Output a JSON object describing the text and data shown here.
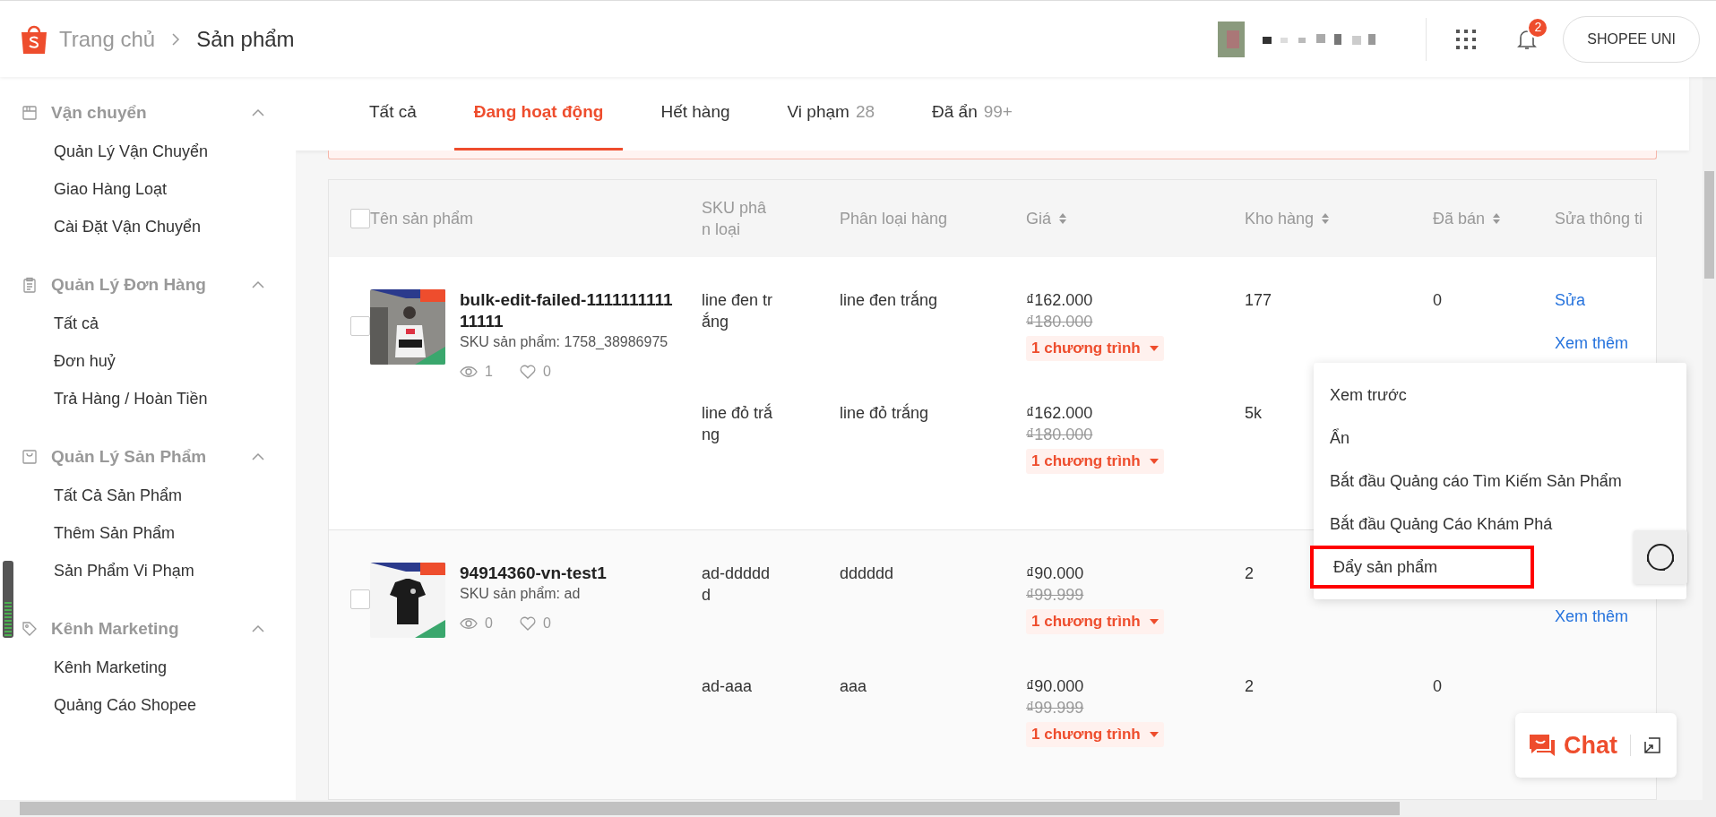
{
  "header": {
    "breadcrumb": [
      "Trang chủ",
      "Sản phẩm"
    ],
    "notification_count": "2",
    "account_button": "SHOPEE UNI"
  },
  "sidebar": [
    {
      "title": "Vận chuyển",
      "expanded": true,
      "items": [
        "Quản Lý Vận Chuyển",
        "Giao Hàng Loạt",
        "Cài Đặt Vận Chuyển"
      ]
    },
    {
      "title": "Quản Lý Đơn Hàng",
      "expanded": true,
      "items": [
        "Tất cả",
        "Đơn huỷ",
        "Trả Hàng / Hoàn Tiền"
      ]
    },
    {
      "title": "Quản Lý Sản Phẩm",
      "expanded": true,
      "items": [
        "Tất Cả Sản Phẩm",
        "Thêm Sản Phẩm",
        "Sản Phẩm Vi Phạm"
      ]
    },
    {
      "title": "Kênh Marketing",
      "expanded": true,
      "items": [
        "Kênh Marketing",
        "Quảng Cáo Shopee"
      ]
    }
  ],
  "tabs": [
    {
      "label": "Tất cả",
      "selected": false
    },
    {
      "label": "Đang hoạt động",
      "selected": true
    },
    {
      "label": "Hết hàng",
      "selected": false
    },
    {
      "label": "Vi phạm",
      "count": "28",
      "selected": false
    },
    {
      "label": "Đã ẩn",
      "count": "99+",
      "selected": false
    }
  ],
  "table": {
    "select_all_checked": false,
    "columns": [
      {
        "label": "Tên sản phẩm",
        "sortable": false
      },
      {
        "label": "SKU phân loại",
        "sortable": false
      },
      {
        "label": "Phân loại hàng",
        "sortable": false
      },
      {
        "label": "Giá",
        "sortable": true
      },
      {
        "label": "Kho hàng",
        "sortable": true
      },
      {
        "label": "Đã bán",
        "sortable": true
      },
      {
        "label": "Sửa thông ti",
        "sortable": false
      }
    ],
    "products": [
      {
        "name": "bulk-edit-failed-111111111111111",
        "sku": "SKU sản phẩm: 1758_38986975",
        "views": "1",
        "likes": "0",
        "checked": false,
        "actions": [
          "Sửa",
          "Xem thêm"
        ],
        "variants": [
          {
            "sku": "line đen trắng",
            "classification": "line đen trắng",
            "price": "₫162.000",
            "original_price": "₫180.000",
            "promotion": "1 chương trình",
            "stock": "177",
            "sold": "0"
          },
          {
            "sku": "line đỏ trắng",
            "classification": "line đỏ trắng",
            "price": "₫162.000",
            "original_price": "₫180.000",
            "promotion": "1 chương trình",
            "stock": "5k"
          }
        ]
      },
      {
        "name": "94914360-vn-test1",
        "sku": "SKU sản phẩm: ad",
        "views": "0",
        "likes": "0",
        "checked": false,
        "actions": [
          "Xem thêm"
        ],
        "variants": [
          {
            "sku": "ad-dddddd",
            "classification": "dddddd",
            "price": "₫90.000",
            "original_price": "₫99.999",
            "promotion": "1 chương trình",
            "stock": "2"
          },
          {
            "sku": "ad-aaa",
            "classification": "aaa",
            "price": "₫90.000",
            "original_price": "₫99.999",
            "promotion": "1 chương trình",
            "stock": "2",
            "sold": "0"
          }
        ]
      }
    ]
  },
  "menu": {
    "items": [
      {
        "label": "Xem trước",
        "highlighted": false
      },
      {
        "label": "Ẩn",
        "highlighted": false
      },
      {
        "label": "Bắt đầu Quảng cáo Tìm Kiếm Sản Phẩm",
        "highlighted": false
      },
      {
        "label": "Bắt đầu Quảng Cáo Khám Phá",
        "highlighted": false
      },
      {
        "label": "Đẩy sản phẩm",
        "highlighted": true
      }
    ]
  },
  "chat": {
    "label": "Chat"
  }
}
